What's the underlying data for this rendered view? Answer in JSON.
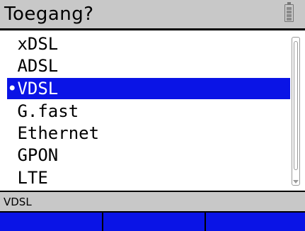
{
  "header": {
    "title": "Toegang?",
    "battery_icon": "battery-icon"
  },
  "list": {
    "items": [
      {
        "label": " xDSL"
      },
      {
        "label": " ADSL"
      },
      {
        "label": "•VDSL",
        "selected": true
      },
      {
        "label": " G.fast"
      },
      {
        "label": " Ethernet"
      },
      {
        "label": " GPON"
      },
      {
        "label": " LTE"
      }
    ]
  },
  "status": {
    "text": "VDSL"
  },
  "softkeys": [
    {
      "label": ""
    },
    {
      "label": ""
    },
    {
      "label": ""
    }
  ],
  "colors": {
    "selection": "#0a14e6",
    "bar_gray": "#c8c8c8"
  }
}
